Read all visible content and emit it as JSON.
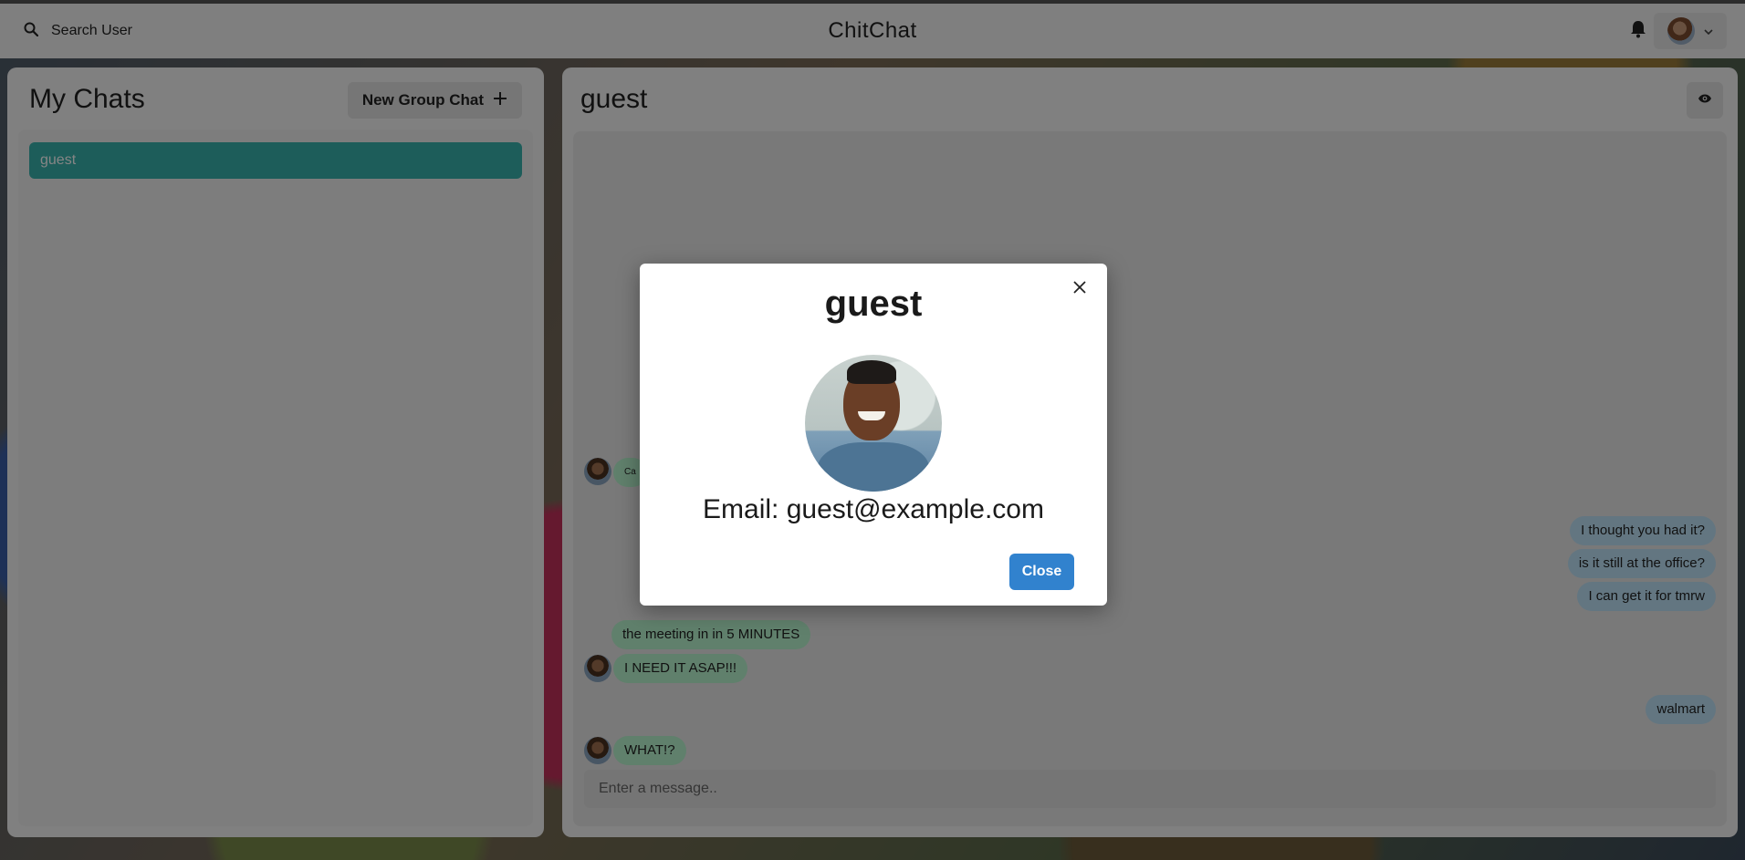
{
  "header": {
    "search_label": "Search User",
    "app_title": "ChitChat",
    "icons": {
      "search": "search-icon",
      "bell": "bell-icon",
      "chevron": "chevron-down-icon"
    }
  },
  "sidebar": {
    "title": "My Chats",
    "new_group_label": "New Group Chat",
    "chats": [
      {
        "name": "guest",
        "selected": true
      }
    ]
  },
  "chat": {
    "title": "guest",
    "messages": [
      {
        "text": "Ca",
        "direction": "in"
      },
      {
        "text": "I thought you had it?",
        "direction": "out"
      },
      {
        "text": "is it still at the office?",
        "direction": "out"
      },
      {
        "text": "I can get it for tmrw",
        "direction": "out"
      },
      {
        "text": "the meeting in in 5 MINUTES",
        "direction": "in"
      },
      {
        "text": "I NEED IT ASAP!!!",
        "direction": "in"
      },
      {
        "text": "walmart",
        "direction": "out"
      },
      {
        "text": "WHAT!?",
        "direction": "in"
      }
    ],
    "input_placeholder": "Enter a message.."
  },
  "modal": {
    "title": "guest",
    "email_text": "Email: guest@example.com",
    "close_label": "Close"
  },
  "colors": {
    "accent": "#38b2ac",
    "primary_button": "#3182ce",
    "incoming_bubble": "#b9f5d0",
    "outgoing_bubble": "#bee3f8"
  }
}
